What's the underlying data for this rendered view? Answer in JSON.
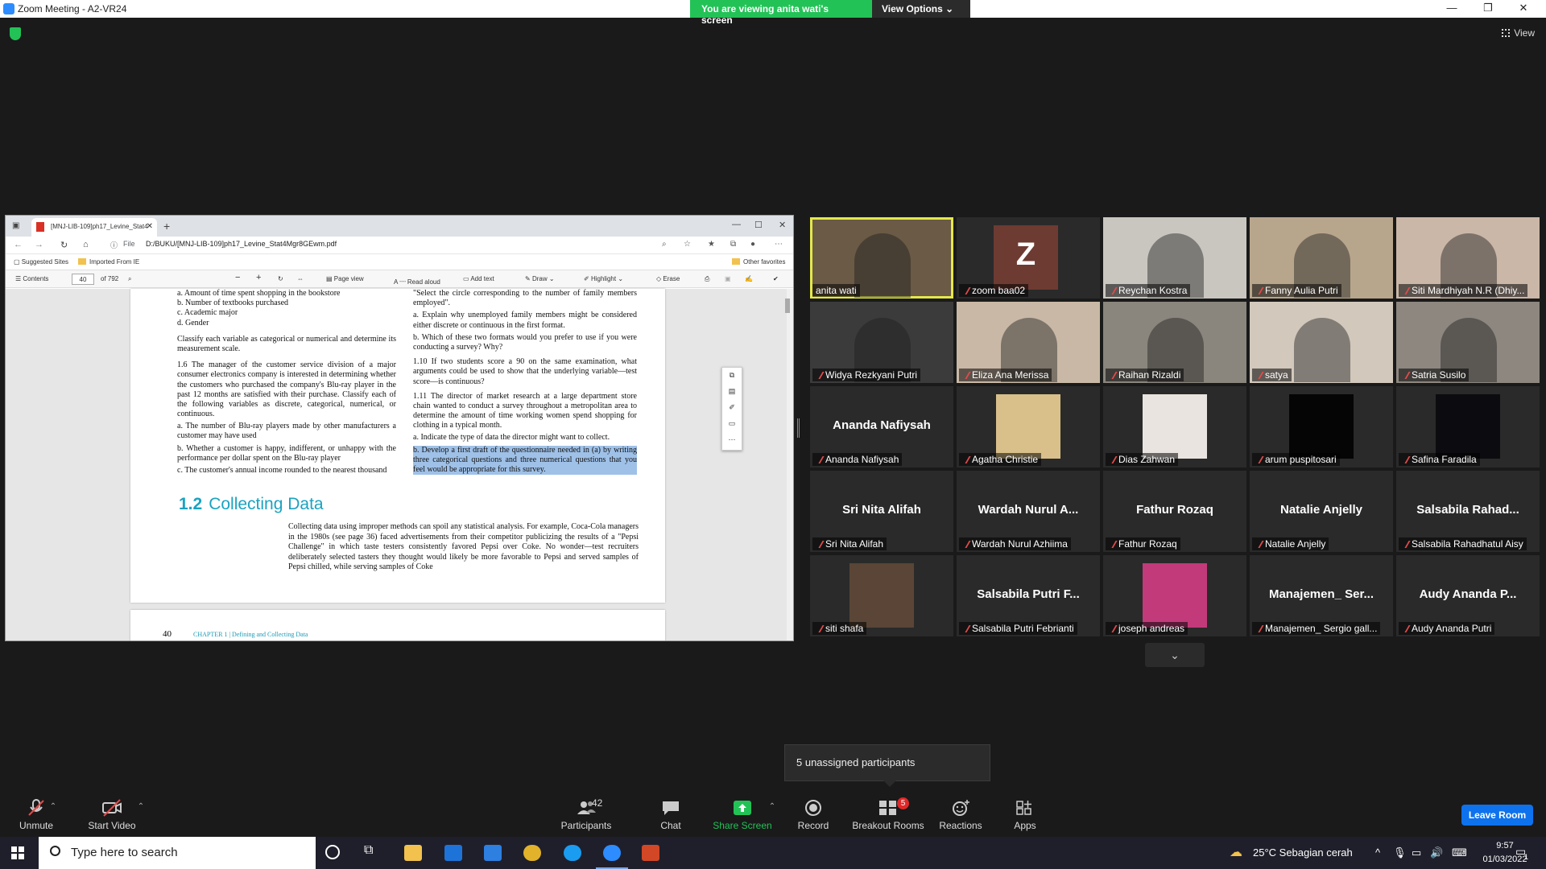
{
  "window": {
    "title": "Zoom Meeting - A2-VR24",
    "share_banner": "You are viewing anita wati's screen",
    "view_options": "View Options",
    "view_label": "View",
    "min": "—",
    "max": "❐",
    "close": "✕"
  },
  "browser": {
    "tab_title": "[MNJ-LIB-109]ph17_Levine_Stat4",
    "file_label": "File",
    "url": "D:/BUKU/[MNJ-LIB-109]ph17_Levine_Stat4Mgr8GEwm.pdf",
    "favorites": [
      "Suggested Sites",
      "Imported From IE"
    ],
    "other_favorites": "Other favorites"
  },
  "pdf_toolbar": {
    "contents": "Contents",
    "page": "40",
    "of_pages": "of 792",
    "page_view": "Page view",
    "read_aloud": "Read aloud",
    "add_text": "Add text",
    "draw": "Draw",
    "highlight": "Highlight",
    "erase": "Erase"
  },
  "pdf": {
    "left_col": [
      "a. Amount of time spent shopping in the bookstore",
      "b. Number of textbooks purchased",
      "c. Academic major",
      "d. Gender",
      "Classify each variable as categorical or numerical and determine its measurement scale.",
      "1.6 The manager of the customer service division of a major consumer electronics company is interested in determining whether the customers who purchased the company's Blu-ray player in the past 12 months are satisfied with their purchase. Classify each of the following variables as discrete, categorical, numerical, or continuous.",
      "a. The number of Blu-ray players made by other manufacturers a customer may have used",
      "b. Whether a customer is happy, indifferent, or unhappy with the performance per dollar spent on the Blu-ray player",
      "c. The customer's annual income rounded to the nearest thousand"
    ],
    "right_col": [
      "\"Select the circle corresponding to the number of family members employed\".",
      "a. Explain why unemployed family members might be considered either discrete or continuous in the first format.",
      "b. Which of these two formats would you prefer to use if you were conducting a survey? Why?",
      "1.10 If two students score a 90 on the same examination, what arguments could be used to show that the underlying variable—test score—is continuous?",
      "1.11 The director of market research at a large department store chain wanted to conduct a survey throughout a metropolitan area to determine the amount of time working women spend shopping for clothing in a typical month.",
      "a. Indicate the type of data the director might want to collect."
    ],
    "highlighted": "b. Develop a first draft of the questionnaire needed in (a) by writing three categorical questions and three numerical questions that you feel would be appropriate for this survey.",
    "section_number": "1.2",
    "section_title": "Collecting Data",
    "section_body": "Collecting data using improper methods can spoil any statistical analysis. For example, Coca-Cola managers in the 1980s (see page 36) faced advertisements from their competitor publicizing the results of a \"Pepsi Challenge\" in which taste testers consistently favored Pepsi over Coke. No wonder—test recruiters deliberately selected tasters they thought would likely be more favorable to Pepsi and served samples of Pepsi chilled, while serving samples of Coke",
    "next_page_number": "40",
    "next_page_chapter": "CHAPTER 1 | Defining and Collecting Data"
  },
  "participants_gallery": [
    {
      "name": "anita wati",
      "kind": "video",
      "color": "#6b5a45",
      "active": true
    },
    {
      "name": "zoom baa02",
      "kind": "avatar",
      "initial": "Z"
    },
    {
      "name": "Reychan Kostra",
      "kind": "video",
      "color": "#c9c6c0"
    },
    {
      "name": "Fanny Aulia Putri",
      "kind": "video",
      "color": "#b8a68c"
    },
    {
      "name": "Siti Mardhiyah N.R (Dhiy...",
      "kind": "video",
      "color": "#cbb7a8"
    },
    {
      "name": "Widya Rezkyani Putri",
      "kind": "video",
      "color": "#3b3b3b"
    },
    {
      "name": "Eliza Ana Merissa",
      "kind": "video",
      "color": "#c9b8a6"
    },
    {
      "name": "Raihan Rizaldi",
      "kind": "video",
      "color": "#8a857d"
    },
    {
      "name": "satya",
      "kind": "video",
      "color": "#d2c8bc"
    },
    {
      "name": "Satria Susilo",
      "kind": "video",
      "color": "#8d8780"
    },
    {
      "name": "Ananda Nafiysah",
      "kind": "name",
      "big": "Ananda Nafiysah"
    },
    {
      "name": "Agatha Christie",
      "kind": "thumb",
      "color": "#d9c08a"
    },
    {
      "name": "Dias Zahwan",
      "kind": "thumb",
      "color": "#e9e4df"
    },
    {
      "name": "arum puspitosari",
      "kind": "thumb",
      "color": "#050505"
    },
    {
      "name": "Safina Faradila",
      "kind": "thumb",
      "color": "#0c0c10"
    },
    {
      "name": "Sri Nita Alifah",
      "kind": "name",
      "big": "Sri Nita Alifah"
    },
    {
      "name": "Wardah Nurul Azhiima",
      "kind": "name",
      "big": "Wardah Nurul A..."
    },
    {
      "name": "Fathur Rozaq",
      "kind": "name",
      "big": "Fathur Rozaq"
    },
    {
      "name": "Natalie Anjelly",
      "kind": "name",
      "big": "Natalie Anjelly"
    },
    {
      "name": "Salsabila Rahadhatul Aisy",
      "kind": "name",
      "big": "Salsabila Rahad..."
    },
    {
      "name": "siti shafa",
      "kind": "thumb",
      "color": "#5a4536"
    },
    {
      "name": "Salsabila Putri Febrianti",
      "kind": "name",
      "big": "Salsabila Putri F..."
    },
    {
      "name": "joseph andreas",
      "kind": "thumb",
      "color": "#c23a7a"
    },
    {
      "name": "Manajemen_ Sergio gall...",
      "kind": "name",
      "big": "Manajemen_ Ser..."
    },
    {
      "name": "Audy Ananda Putri",
      "kind": "name",
      "big": "Audy Ananda P..."
    }
  ],
  "toast": "5 unassigned participants",
  "controls": {
    "unmute": "Unmute",
    "start_video": "Start Video",
    "participants": "Participants",
    "participants_count": "42",
    "chat": "Chat",
    "share_screen": "Share Screen",
    "record": "Record",
    "breakout_rooms": "Breakout Rooms",
    "breakout_badge": "5",
    "reactions": "Reactions",
    "apps": "Apps",
    "leave_room": "Leave Room"
  },
  "taskbar": {
    "search_placeholder": "Type here to search",
    "weather": "25°C  Sebagian cerah",
    "time": "9:57",
    "date": "01/03/2022",
    "notif": "1"
  }
}
